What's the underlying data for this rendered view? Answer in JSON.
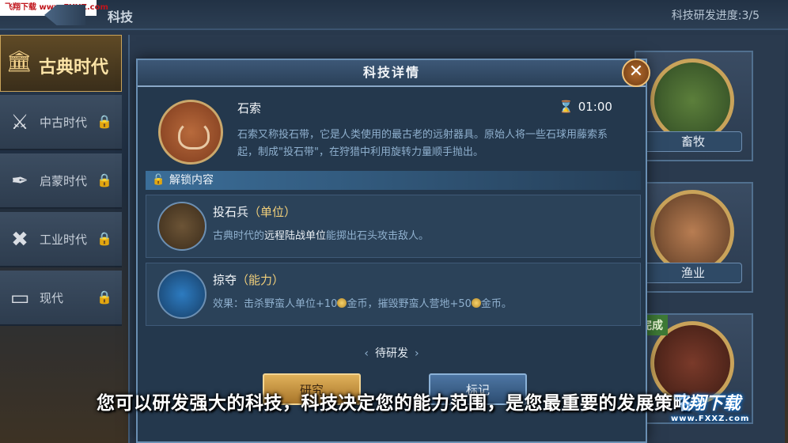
{
  "header": {
    "watermark": "飞翔下载 www.FXXZ.com",
    "title": "科技",
    "progress": "科技研发进度:3/5"
  },
  "sidebar": {
    "eras": [
      {
        "label": "古典时代",
        "icon": "temple-icon",
        "active": true,
        "locked": false
      },
      {
        "label": "中古时代",
        "icon": "crossed-swords-helmet-icon",
        "active": false,
        "locked": true
      },
      {
        "label": "启蒙时代",
        "icon": "quill-ink-icon",
        "active": false,
        "locked": true
      },
      {
        "label": "工业时代",
        "icon": "wrench-tools-icon",
        "active": false,
        "locked": true
      },
      {
        "label": "现代",
        "icon": "monitor-icon",
        "active": false,
        "locked": true
      }
    ]
  },
  "background_cards": [
    {
      "name": "畜牧",
      "status": ""
    },
    {
      "name": "渔业",
      "status": ""
    },
    {
      "name": "",
      "status": "完成"
    }
  ],
  "dialog": {
    "title": "科技详情",
    "tech": {
      "name": "石索",
      "timer": "01:00",
      "description": "石索又称投石带，它是人类使用的最古老的远射器具。原始人将一些石球用藤索系起，制成\"投石带\"，在狩猎中利用旋转力量顺手抛出。"
    },
    "unlock_header": "解锁内容",
    "unlocks": [
      {
        "name": "投石兵",
        "tag": "（单位）",
        "desc_prefix": "古典时代的",
        "desc_highlight": "远程陆战单位",
        "desc_suffix": "能掷出石头攻击敌人。"
      },
      {
        "name": "掠夺",
        "tag": "（能力）",
        "desc_part1": "效果：击杀野蛮人单位+10",
        "desc_part2": "金币，摧毁野蛮人营地+50",
        "desc_part3": "金币。"
      }
    ],
    "status": "待研发",
    "buttons": {
      "research": "研究",
      "mark": "标记"
    }
  },
  "subtitle": "您可以研发强大的科技，科技决定您的能力范围，是您最重要的发展策略",
  "watermark_br": {
    "text": "飞翔下载",
    "url": "www.FXXZ.com"
  }
}
